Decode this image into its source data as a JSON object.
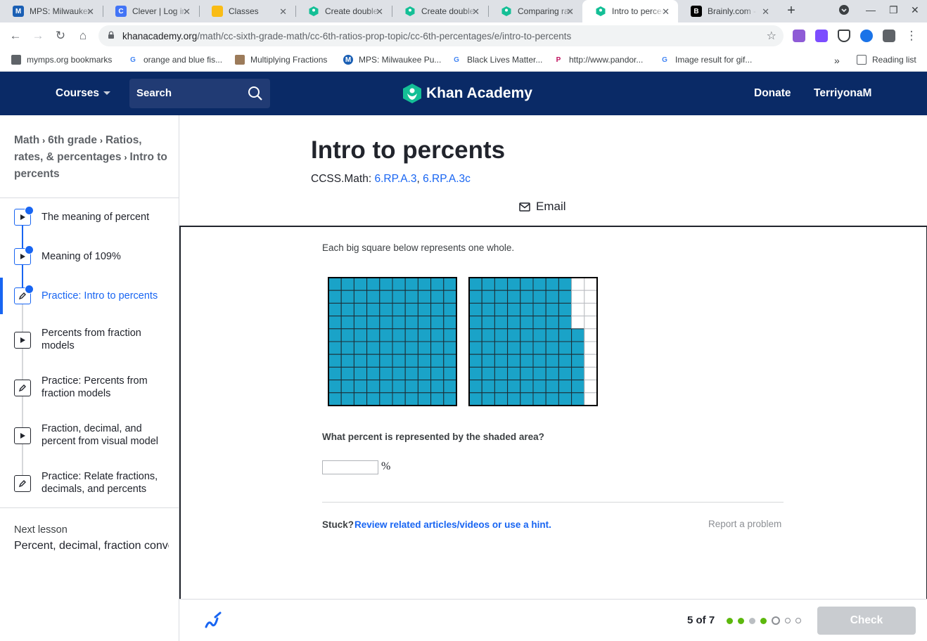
{
  "browser": {
    "tabs": [
      {
        "title": "MPS: Milwaukee Public Schools",
        "icon": "mps-favicon",
        "color": "#1a5fb4"
      },
      {
        "title": "Clever | Log in",
        "icon": "clever-favicon",
        "color": "#4274f6"
      },
      {
        "title": "Classes",
        "icon": "classroom-favicon",
        "color": "#f9bc15"
      },
      {
        "title": "Create double number lines",
        "icon": "khan-favicon",
        "color": "#14bf96"
      },
      {
        "title": "Create double number lines",
        "icon": "khan-favicon",
        "color": "#14bf96"
      },
      {
        "title": "Comparing ratios",
        "icon": "khan-favicon",
        "color": "#14bf96"
      },
      {
        "title": "Intro to percents",
        "icon": "khan-favicon",
        "color": "#14bf96",
        "active": true
      },
      {
        "title": "Brainly.com - For students",
        "icon": "brainly-favicon",
        "color": "#000000"
      }
    ],
    "url_domain": "khanacademy.org",
    "url_path": "/math/cc-sixth-grade-math/cc-6th-ratios-prop-topic/cc-6th-percentages/e/intro-to-percents",
    "bookmarks": [
      {
        "label": "mymps.org bookmarks",
        "icon": "folder-icon"
      },
      {
        "label": "orange and blue fis...",
        "icon": "google-icon"
      },
      {
        "label": "Multiplying Fractions",
        "icon": "page-icon"
      },
      {
        "label": "MPS: Milwaukee Pu...",
        "icon": "mps-icon"
      },
      {
        "label": "Black Lives Matter...",
        "icon": "google-icon"
      },
      {
        "label": "http://www.pandor...",
        "icon": "pandora-icon"
      },
      {
        "label": "Image result for gif...",
        "icon": "google-icon"
      }
    ],
    "reading_list": "Reading list"
  },
  "header": {
    "courses": "Courses",
    "search_placeholder": "Search",
    "logo": "Khan Academy",
    "donate": "Donate",
    "user": "TerriyonaM"
  },
  "sidebar": {
    "breadcrumb": [
      "Math",
      "6th grade",
      "Ratios, rates, & percentages",
      "Intro to percents"
    ],
    "items": [
      {
        "label": "The meaning of percent",
        "type": "video",
        "done": true
      },
      {
        "label": "Meaning of 109%",
        "type": "video",
        "done": true
      },
      {
        "label": "Practice: Intro to percents",
        "type": "practice",
        "done": true,
        "active": true
      },
      {
        "label": "Percents from fraction models",
        "type": "video",
        "done": false
      },
      {
        "label": "Practice: Percents from fraction models",
        "type": "practice",
        "done": false
      },
      {
        "label": "Fraction, decimal, and percent from visual model",
        "type": "video",
        "done": false
      },
      {
        "label": "Practice: Relate fractions, decimals, and percents",
        "type": "practice",
        "done": false
      }
    ],
    "next_label": "Next lesson",
    "next_title": "Percent, decimal, fraction conversions"
  },
  "main": {
    "title": "Intro to percents",
    "ccss_prefix": "CCSS.Math:",
    "standards": [
      "6.RP.A.3",
      "6.RP.A.3c"
    ],
    "email": "Email"
  },
  "exercise": {
    "prompt": "Each big square below represents one whole.",
    "grids": [
      {
        "shaded_cells": 100,
        "total_cells": 100
      },
      {
        "shaded_cells": 86,
        "total_cells": 100,
        "full_columns": 8,
        "partial_column_shaded": 6
      }
    ],
    "question": "What percent is represented by the shaded area?",
    "answer_value": "",
    "unit": "%",
    "stuck": "Stuck?",
    "hint_link": "Review related articles/videos or use a hint.",
    "report": "Report a problem"
  },
  "footer": {
    "progress": "5 of 7",
    "dots": [
      "correct",
      "correct",
      "skipped",
      "correct",
      "current",
      "todo",
      "todo"
    ],
    "check": "Check",
    "colors": {
      "correct": "#5cb80d",
      "skipped": "#babec2",
      "accent": "#1865f2",
      "fill": "#1aa3c8"
    }
  }
}
